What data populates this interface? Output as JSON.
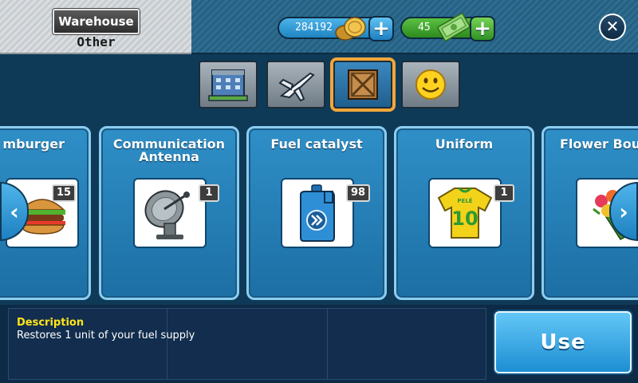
{
  "header": {
    "title": "Warehouse",
    "subtitle": "Other",
    "coins": "284192",
    "cash": "45"
  },
  "icons": {
    "coin": "coin-stack-icon",
    "cash": "banknote-icon",
    "plus": "+",
    "close": "✕"
  },
  "tabs": [
    {
      "name": "buildings",
      "icon": "building-icon",
      "active": false
    },
    {
      "name": "aircraft",
      "icon": "airplane-icon",
      "active": false
    },
    {
      "name": "crates",
      "icon": "crate-icon",
      "active": true
    },
    {
      "name": "smileys",
      "icon": "smiley-icon",
      "active": false
    }
  ],
  "items": [
    {
      "title": "mburger",
      "qty": "15",
      "icon": "hamburger-icon"
    },
    {
      "title": "Communication Antenna",
      "qty": "1",
      "icon": "satellite-dish-icon"
    },
    {
      "title": "Fuel catalyst",
      "qty": "98",
      "icon": "fuel-can-icon"
    },
    {
      "title": "Uniform",
      "qty": "1",
      "icon": "jersey-icon",
      "jersey_name": "PELÉ",
      "jersey_number": "10"
    },
    {
      "title": "Flower Bou",
      "qty": "",
      "icon": "flower-bouquet-icon"
    }
  ],
  "carousel": {
    "prev": "‹",
    "next": "›"
  },
  "description": {
    "label": "Description",
    "text": "Restores 1 unit of your fuel supply"
  },
  "use_button": "Use",
  "colors": {
    "accent": "#f1a73a",
    "card": "#2f8fc7",
    "description_label": "#ffe419"
  }
}
